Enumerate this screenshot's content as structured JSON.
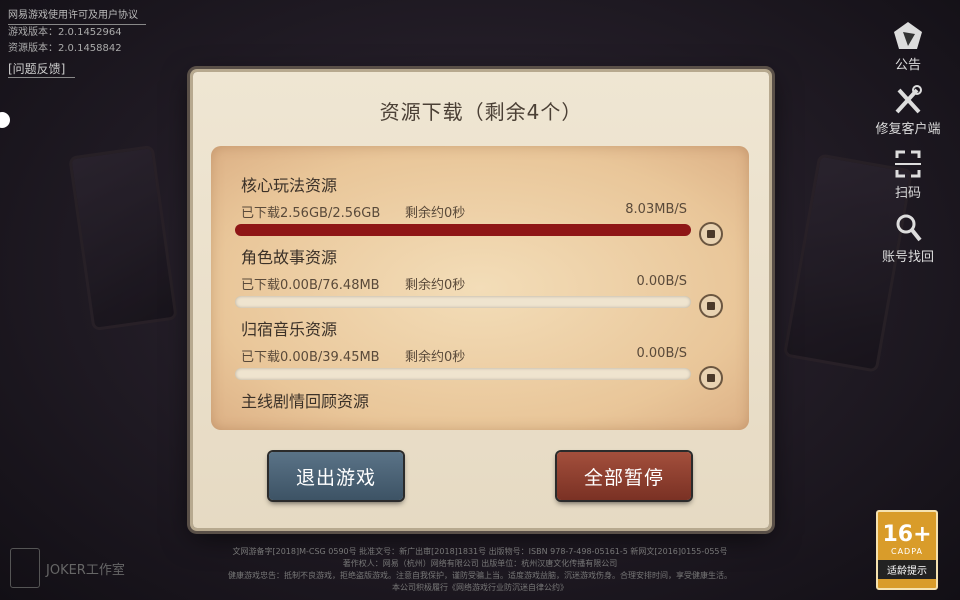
{
  "top_info": {
    "license_link": "网易游戏使用许可及用户协议",
    "game_version": "游戏版本：2.0.1452964",
    "resource_version": "资源版本：2.0.1458842",
    "feedback": "[问题反馈]"
  },
  "right_menu": [
    {
      "label": "公告",
      "icon": "announcement-icon"
    },
    {
      "label": "修复客户端",
      "icon": "repair-tools-icon"
    },
    {
      "label": "扫码",
      "icon": "scan-icon"
    },
    {
      "label": "账号找回",
      "icon": "account-recovery-icon"
    }
  ],
  "dialog": {
    "title": "资源下载（剩余4个）",
    "items": [
      {
        "name": "核心玩法资源",
        "downloaded": "已下载2.56GB/2.56GB",
        "remain": "剩余约0秒",
        "speed": "8.03MB/S",
        "progress": 1.0
      },
      {
        "name": "角色故事资源",
        "downloaded": "已下载0.00B/76.48MB",
        "remain": "剩余约0秒",
        "speed": "0.00B/S",
        "progress": 0.0
      },
      {
        "name": "归宿音乐资源",
        "downloaded": "已下载0.00B/39.45MB",
        "remain": "剩余约0秒",
        "speed": "0.00B/S",
        "progress": 0.0
      },
      {
        "name": "主线剧情回顾资源"
      }
    ],
    "exit_button": "退出游戏",
    "pause_all_button": "全部暂停"
  },
  "footer": {
    "line1": "文网游备字[2018]M-CSG 0590号  批准文号：新广出审[2018]1831号  出版物号：ISBN 978-7-498-05161-5  新网文[2016]0155-055号",
    "line2": "著作权人：网易（杭州）网络有限公司  出版单位：杭州汉唐文化传播有限公司",
    "line3": "健康游戏忠告：抵制不良游戏，拒绝盗版游戏。注意自我保护，谨防受骗上当。适度游戏益脑，沉迷游戏伤身。合理安排时间，享受健康生活。",
    "line4": "本公司积极履行《网络游戏行业防沉迷自律公约》"
  },
  "logo_text": "JOKER工作室",
  "age_rating": {
    "number": "16+",
    "org": "CADPA",
    "tip": "适龄提示"
  },
  "colors": {
    "progress_fill": "#8f1616",
    "exit_button": "#4a6174",
    "pause_button": "#8d3d2e"
  }
}
